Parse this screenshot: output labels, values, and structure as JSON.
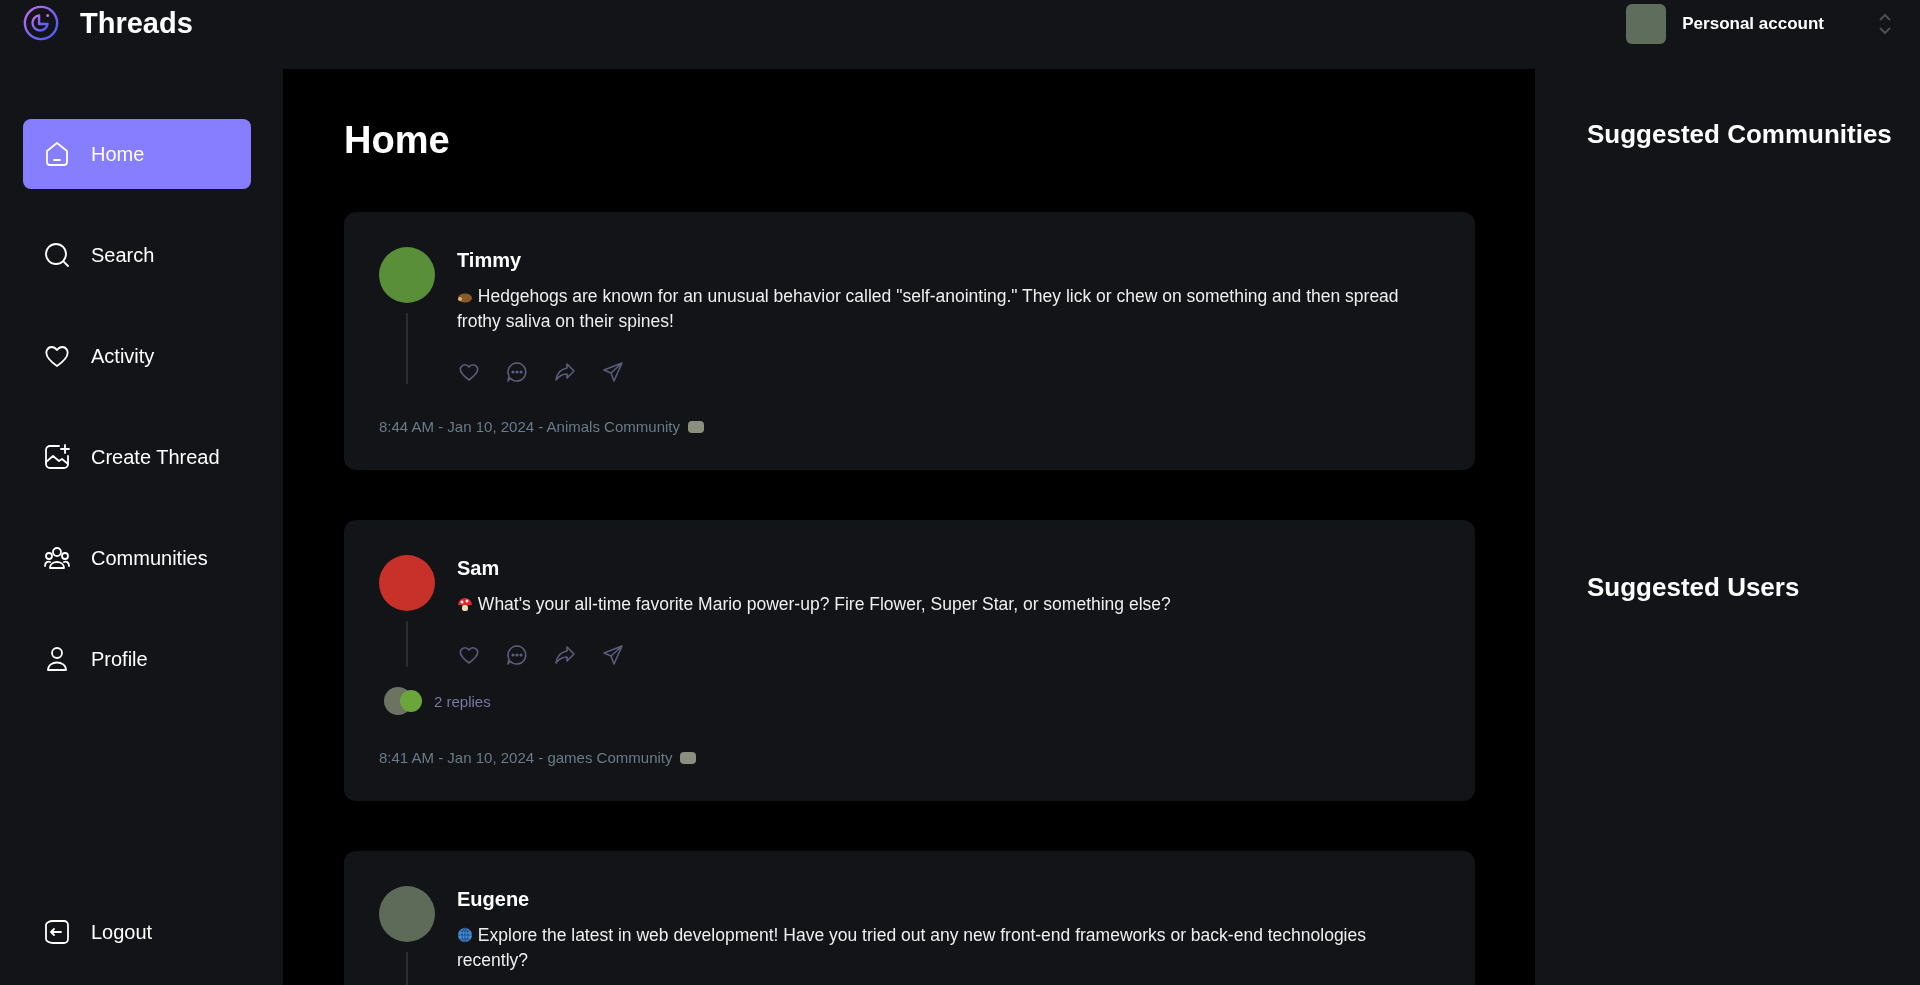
{
  "app": {
    "title": "Threads"
  },
  "account": {
    "label": "Personal account"
  },
  "sidebar": {
    "items": [
      {
        "label": "Home",
        "kind": "home",
        "selected": true
      },
      {
        "label": "Search",
        "kind": "search",
        "selected": false
      },
      {
        "label": "Activity",
        "kind": "activity",
        "selected": false
      },
      {
        "label": "Create Thread",
        "kind": "create",
        "selected": false
      },
      {
        "label": "Communities",
        "kind": "communities",
        "selected": false
      },
      {
        "label": "Profile",
        "kind": "profile",
        "selected": false
      }
    ],
    "logout": {
      "label": "Logout"
    }
  },
  "main": {
    "title": "Home",
    "posts": [
      {
        "author": "Timmy",
        "text": "Hedgehogs are known for an unusual behavior called \"self-anointing.\" They lick or chew on something and then spread frothy saliva on their spines!",
        "meta": "8:44 AM - Jan 10, 2024 - Animals Community"
      },
      {
        "author": "Sam",
        "text": "What's your all-time favorite Mario power-up? Fire Flower, Super Star, or something else?",
        "replies": "2 replies",
        "meta": "8:41 AM - Jan 10, 2024 - games Community"
      },
      {
        "author": "Eugene",
        "text": "Explore the latest in web development! Have you tried out any new front-end frameworks or back-end technologies recently?"
      }
    ]
  },
  "rightbar": {
    "sections": [
      {
        "title": "Suggested Communities"
      },
      {
        "title": "Suggested Users"
      }
    ]
  }
}
